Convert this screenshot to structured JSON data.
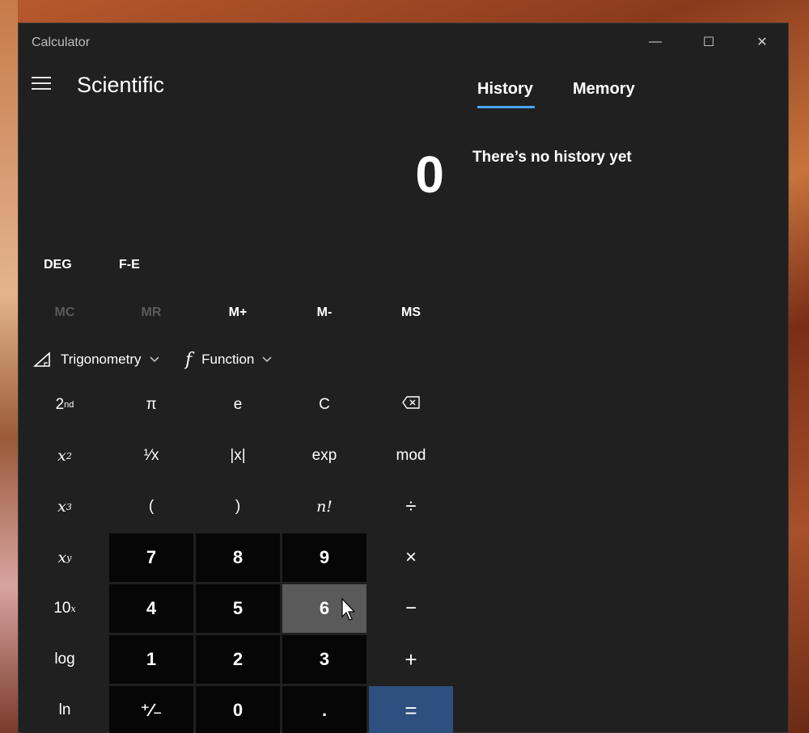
{
  "app": {
    "window_title": "Calculator",
    "mode_title": "Scientific"
  },
  "window_controls": {
    "minimize": "—",
    "maximize": "☐",
    "close": "✕"
  },
  "panel": {
    "tabs": [
      {
        "label": "History",
        "selected": true
      },
      {
        "label": "Memory",
        "selected": false
      }
    ],
    "empty_message": "There’s no history yet"
  },
  "display": {
    "value": "0"
  },
  "mode_buttons": {
    "angle": "DEG",
    "notation": "F-E"
  },
  "memory": {
    "buttons": [
      {
        "label": "MC",
        "enabled": false
      },
      {
        "label": "MR",
        "enabled": false
      },
      {
        "label": "M+",
        "enabled": true
      },
      {
        "label": "M-",
        "enabled": true
      },
      {
        "label": "MS",
        "enabled": true
      }
    ]
  },
  "dropdowns": {
    "trigonometry": "Trigonometry",
    "function": "Function",
    "function_glyph": "f"
  },
  "keys": {
    "row1": [
      "2",
      "π",
      "e",
      "C",
      "backspace"
    ],
    "row1_sup": "nd",
    "row2": [
      "x",
      "¹⁄x",
      "|x|",
      "exp",
      "mod"
    ],
    "row3": [
      "x",
      "(",
      ")",
      "n!",
      "÷"
    ],
    "row4": [
      "x",
      "7",
      "8",
      "9",
      "×"
    ],
    "row5": [
      "10",
      "4",
      "5",
      "6",
      "−"
    ],
    "row6": [
      "log",
      "1",
      "2",
      "3",
      "+"
    ],
    "row7": [
      "ln",
      "⁺∕₋",
      "0",
      ".",
      "="
    ],
    "sup_2": "2",
    "sup_3": "3",
    "sup_y": "y",
    "sup_x": "x"
  },
  "colors": {
    "window_bg": "#202020",
    "number_key_bg": "#060606",
    "hover_key_bg": "#5a5a5a",
    "equals_bg": "#2d5080",
    "accent": "#4aa3ff"
  }
}
